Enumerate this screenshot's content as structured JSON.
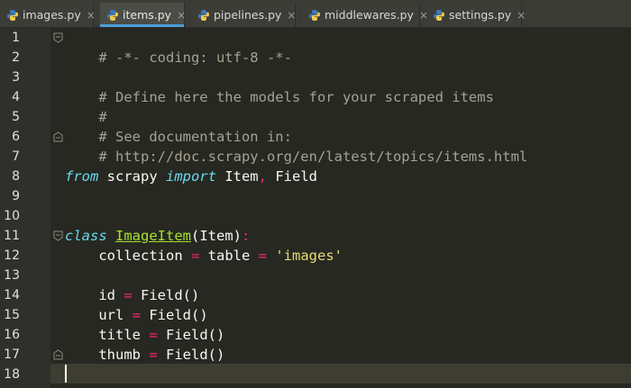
{
  "tabs": [
    {
      "label": "images.py",
      "close": "×"
    },
    {
      "label": "items.py",
      "close": "×"
    },
    {
      "label": "pipelines.py",
      "close": "×"
    },
    {
      "label": "middlewares.py",
      "close": "×"
    },
    {
      "label": "settings.py",
      "close": "×"
    }
  ],
  "active_tab": "items.py",
  "line_numbers": [
    "1",
    "2",
    "3",
    "4",
    "5",
    "6",
    "7",
    "8",
    "9",
    "10",
    "11",
    "12",
    "13",
    "14",
    "15",
    "16",
    "17",
    "18"
  ],
  "code": {
    "l1": "# -*- coding: utf-8 -*-",
    "l3": "# Define here the models for your scraped items",
    "l4": "#",
    "l5": "# See documentation in:",
    "l6": "# http://doc.scrapy.org/en/latest/topics/items.html",
    "l8_from": "from",
    "l8_mod": " scrapy ",
    "l8_import": "import",
    "l8_item": " Item",
    "l8_comma": ",",
    "l8_field": " Field",
    "l11_class": "class",
    "l11_name": "ImageItem",
    "l11_base": "(Item)",
    "l11_colon": ":",
    "l12_a": "    collection ",
    "l12_eq": "=",
    "l12_b": " table ",
    "l12_eq2": "=",
    "l12_str": " 'images'",
    "l14_a": "    id ",
    "l14_eq": "=",
    "l14_b": " Field()",
    "l15_a": "    url ",
    "l15_eq": "=",
    "l15_b": " Field()",
    "l16_a": "    title ",
    "l16_eq": "=",
    "l16_b": " Field()",
    "l17_a": "    thumb ",
    "l17_eq": "=",
    "l17_b": " Field()"
  },
  "colors": {
    "background": "#272822",
    "keyword": "#66d9ef",
    "comment": "#a5a292",
    "operator": "#f92672",
    "class_name": "#a6e22e",
    "string": "#e6db74",
    "active_tab_underline": "#4a9fd8"
  },
  "icons": {
    "tab_file_icon": "python-file-icon",
    "tab_close_icon": "close-icon",
    "fold_icon": "fold-marker-icon"
  }
}
